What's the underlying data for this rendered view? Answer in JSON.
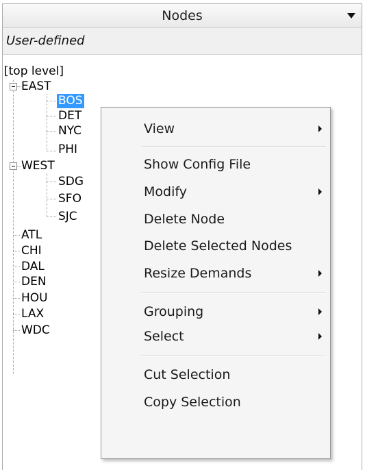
{
  "panel": {
    "title": "Nodes",
    "dropdown_icon": "chevron-down-icon",
    "subheader": "User-defined"
  },
  "tree": {
    "root": "[top level]",
    "groups": [
      {
        "label": "EAST",
        "expanded": true,
        "children": [
          "BOS",
          "DET",
          "NYC",
          "PHI"
        ]
      },
      {
        "label": "WEST",
        "expanded": true,
        "children": [
          "SDG",
          "SFO",
          "SJC"
        ]
      }
    ],
    "nodes": [
      "ATL",
      "CHI",
      "DAL",
      "DEN",
      "HOU",
      "LAX",
      "WDC"
    ],
    "selected": "BOS",
    "selection_color": "#3399ff"
  },
  "context_menu": {
    "items": [
      {
        "label": "View",
        "submenu": true
      },
      {
        "label": "Show Config File",
        "submenu": false
      },
      {
        "label": "Modify",
        "submenu": true
      },
      {
        "label": "Delete Node",
        "submenu": false
      },
      {
        "label": "Delete Selected Nodes",
        "submenu": false
      },
      {
        "label": "Resize Demands",
        "submenu": true
      },
      {
        "label": "Grouping",
        "submenu": true
      },
      {
        "label": "Select",
        "submenu": true
      },
      {
        "label": "Cut Selection",
        "submenu": false
      },
      {
        "label": "Copy Selection",
        "submenu": false
      }
    ]
  }
}
